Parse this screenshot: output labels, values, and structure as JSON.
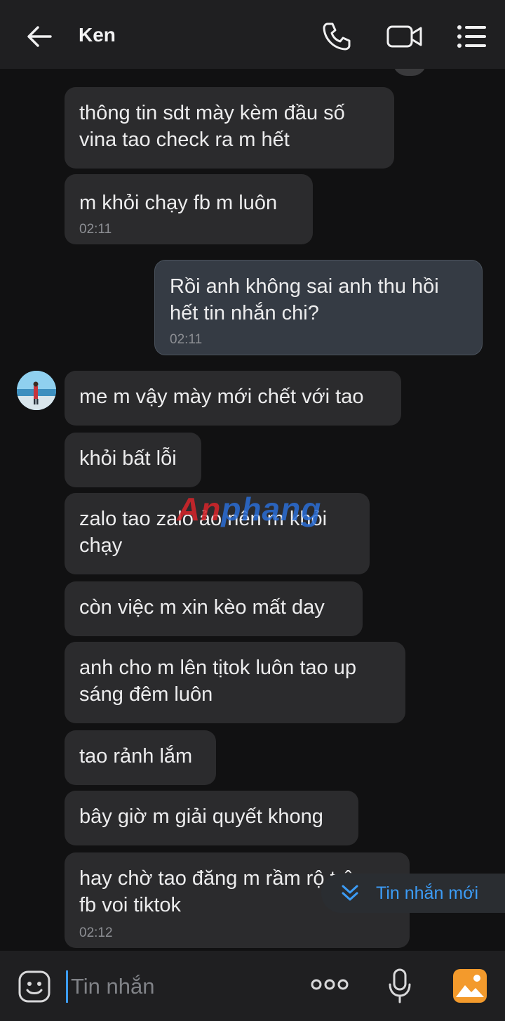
{
  "header": {
    "contact_name": "Ken",
    "icons": [
      "back-arrow-icon",
      "phone-icon",
      "video-camera-icon",
      "list-menu-icon"
    ]
  },
  "messages": [
    {
      "from": "contact",
      "text_lines": [
        "thông tin sdt mày kèm đầu số",
        "vina tao check ra m hết"
      ],
      "time": ""
    },
    {
      "from": "contact",
      "text_lines": [
        "m khỏi chạy fb m luôn"
      ],
      "time": "02:11"
    },
    {
      "from": "me",
      "text_lines": [
        "Rồi anh không sai anh thu hồi",
        "hết tin nhắn chi?"
      ],
      "time": "02:11"
    },
    {
      "from": "contact",
      "text_lines": [
        "me m vậy mày mới chết với tao"
      ],
      "time": ""
    },
    {
      "from": "contact",
      "text_lines": [
        "khỏi bất lỗi"
      ],
      "time": ""
    },
    {
      "from": "contact",
      "text_lines": [
        "zalo tao zalo ảo nên m khỏi",
        "chạy"
      ],
      "time": ""
    },
    {
      "from": "contact",
      "text_lines": [
        "còn việc m xin kèo mất day"
      ],
      "time": ""
    },
    {
      "from": "contact",
      "text_lines": [
        "anh cho m lên tịtok luôn tao up",
        "sáng đêm luôn"
      ],
      "time": ""
    },
    {
      "from": "contact",
      "text_lines": [
        "tao rảnh lắm"
      ],
      "time": ""
    },
    {
      "from": "contact",
      "text_lines": [
        "bây giờ m giải quyết khong"
      ],
      "time": ""
    },
    {
      "from": "contact",
      "text_lines": [
        "hay chờ tao đăng m rầm rộ trên",
        "fb voi tiktok"
      ],
      "time": "02:12"
    }
  ],
  "watermark": {
    "part1": "An",
    "part2": "phang"
  },
  "new_message_pill": {
    "label": "Tin nhắn mới",
    "icon": "double-chevron-down-icon"
  },
  "input": {
    "placeholder": "Tin nhắn",
    "icons": [
      "sticker-icon",
      "more-dots-icon",
      "microphone-icon",
      "photo-icon"
    ]
  },
  "colors": {
    "background": "#111112",
    "header": "#1f1f21",
    "bubble_contact": "#2b2b2d",
    "bubble_me": "#353b44",
    "accent": "#3c9cf6"
  }
}
